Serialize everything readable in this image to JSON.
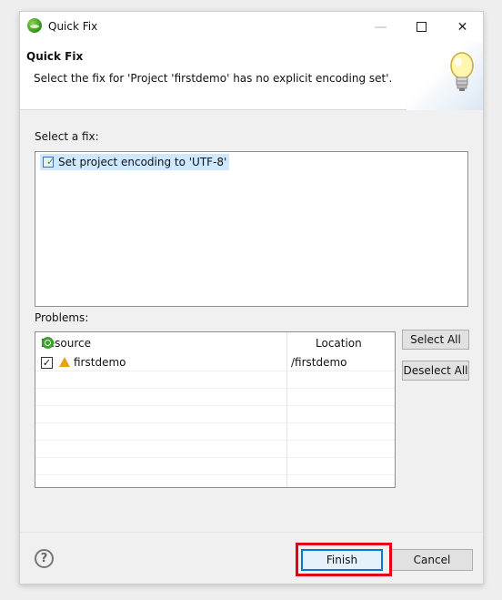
{
  "window": {
    "title": "Quick Fix",
    "minimize_glyph": "—",
    "close_glyph": "✕"
  },
  "header": {
    "title": "Quick Fix",
    "message": "Select the fix for 'Project 'firstdemo' has no explicit encoding set'."
  },
  "fixes": {
    "label": "Select a fix:",
    "items": [
      {
        "label": "Set project encoding to 'UTF-8'",
        "icon": "change-icon",
        "selected": true
      }
    ]
  },
  "problems": {
    "label": "Problems:",
    "columns": [
      "Resource",
      "Location"
    ],
    "rows": [
      {
        "checked": true,
        "resource": "firstdemo",
        "location": "/firstdemo",
        "icon": "warning-icon"
      }
    ],
    "check_glyph": "✓",
    "select_all_label": "Select All",
    "deselect_all_label": "Deselect All"
  },
  "footer": {
    "help_glyph": "?",
    "finish_label": "Finish",
    "cancel_label": "Cancel"
  },
  "colors": {
    "selection": "#cde8ff",
    "highlight_annotation": "#e3001b",
    "default_button_border": "#0078d7"
  }
}
